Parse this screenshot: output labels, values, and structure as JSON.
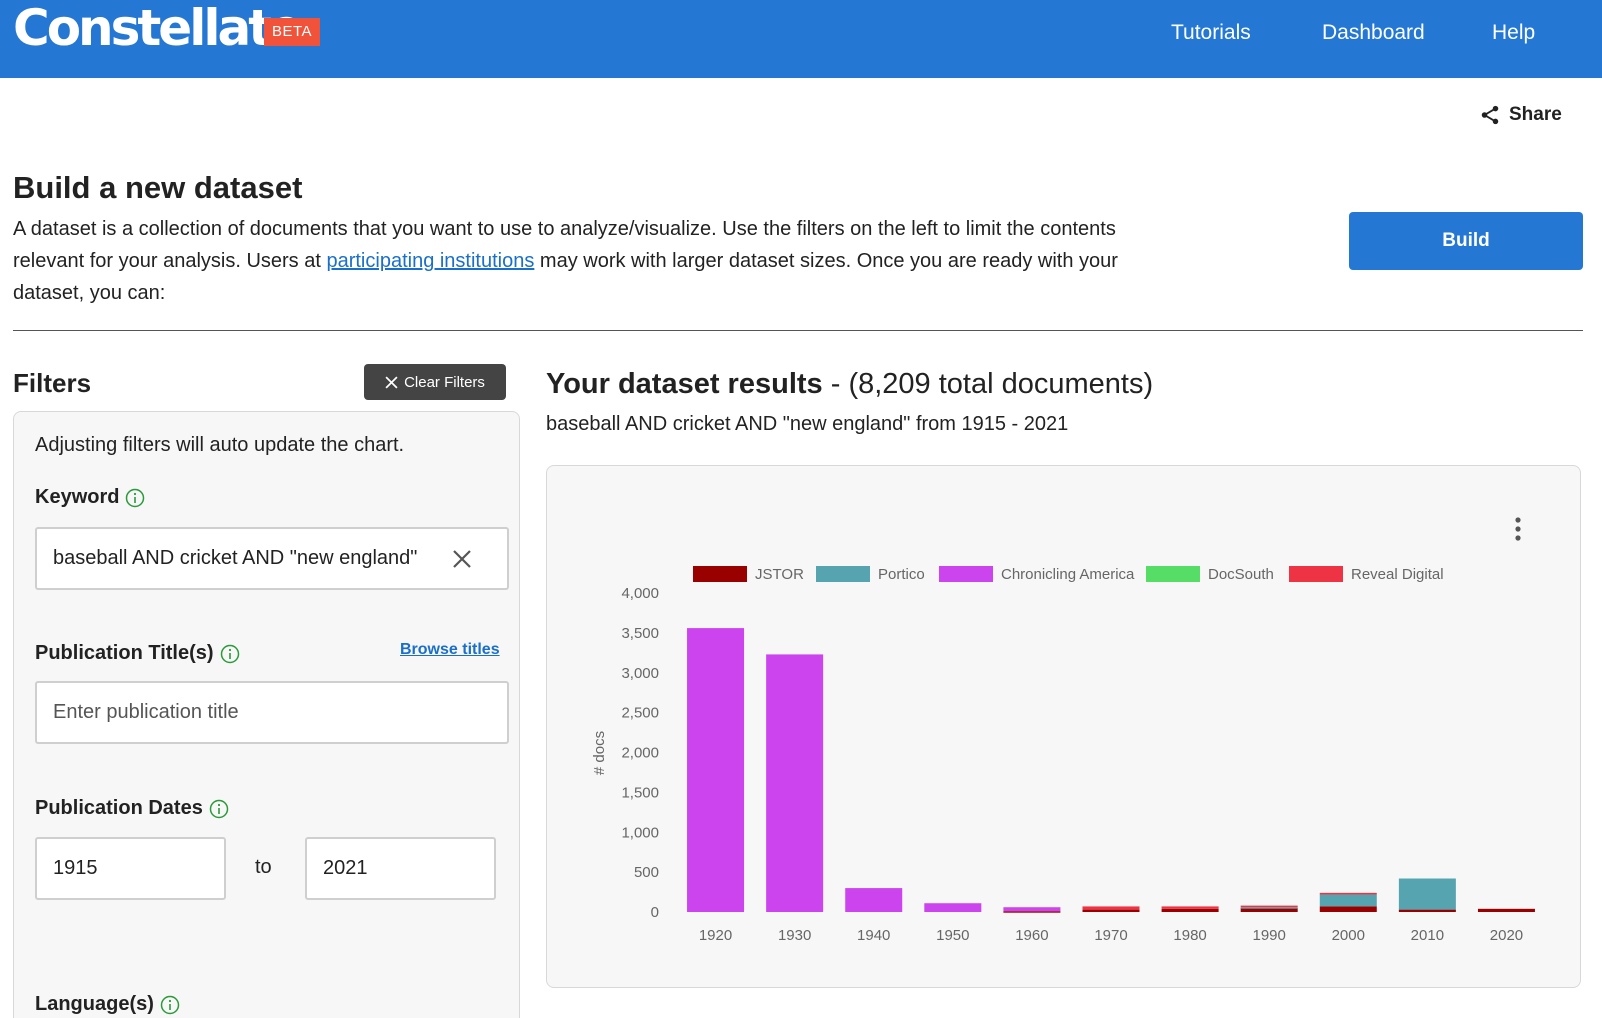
{
  "header": {
    "logo": "Constellate",
    "badge": "BETA",
    "nav": [
      "Tutorials",
      "Dashboard",
      "Help"
    ]
  },
  "share_label": "Share",
  "intro": {
    "title": "Build a new dataset",
    "text_before_link": "A dataset is a collection of documents that you want to use to analyze/visualize. Use the filters on the left to limit the contents relevant for your analysis. Users at ",
    "link_text": "participating institutions",
    "text_after_link": " may work with larger dataset sizes. Once you are ready with your dataset, you can:",
    "build_label": "Build"
  },
  "filters": {
    "title": "Filters",
    "clear_label": "Clear Filters",
    "hint": "Adjusting filters will auto update the chart.",
    "keyword_label": "Keyword",
    "keyword_value": "baseball AND cricket AND \"new england\"",
    "pub_title_label": "Publication Title(s)",
    "browse_label": "Browse titles",
    "pub_title_placeholder": "Enter publication title",
    "dates_label": "Publication Dates",
    "date_from": "1915",
    "to_label": "to",
    "date_to": "2021",
    "language_label": "Language(s)"
  },
  "results": {
    "title_bold": "Your dataset results",
    "title_rest": " - (8,209 total documents)",
    "query": "baseball AND cricket AND \"new england\" from 1915 - 2021"
  },
  "chart_data": {
    "type": "bar",
    "stacked": true,
    "ylabel": "# docs",
    "ylim": [
      0,
      4000
    ],
    "yticks": [
      0,
      500,
      1000,
      1500,
      2000,
      2500,
      3000,
      3500,
      4000
    ],
    "ytick_labels": [
      "0",
      "500",
      "1,000",
      "1,500",
      "2,000",
      "2,500",
      "3,000",
      "3,500",
      "4,000"
    ],
    "categories": [
      "1920",
      "1930",
      "1940",
      "1950",
      "1960",
      "1970",
      "1980",
      "1990",
      "2000",
      "2010",
      "2020"
    ],
    "legend_position": "top",
    "series": [
      {
        "name": "JSTOR",
        "color": "#990000",
        "values": [
          0,
          0,
          0,
          0,
          10,
          30,
          40,
          50,
          70,
          30,
          40
        ]
      },
      {
        "name": "Portico",
        "color": "#55a4b0",
        "values": [
          0,
          0,
          0,
          0,
          0,
          0,
          0,
          10,
          150,
          390,
          0
        ]
      },
      {
        "name": "Chronicling America",
        "color": "#cc44ee",
        "values": [
          3560,
          3230,
          300,
          110,
          50,
          0,
          0,
          0,
          0,
          0,
          0
        ]
      },
      {
        "name": "DocSouth",
        "color": "#55dd66",
        "values": [
          0,
          0,
          0,
          0,
          0,
          0,
          0,
          0,
          0,
          0,
          0
        ]
      },
      {
        "name": "Reveal Digital",
        "color": "#ee3344",
        "values": [
          0,
          0,
          0,
          0,
          0,
          40,
          30,
          20,
          20,
          0,
          0
        ]
      }
    ]
  }
}
